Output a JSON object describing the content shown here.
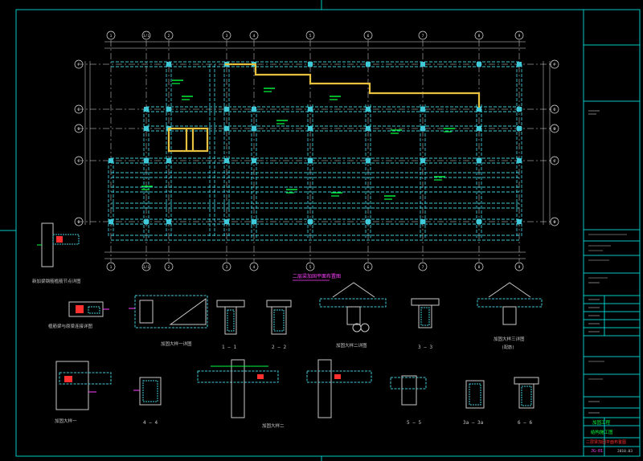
{
  "title_block": {
    "project_name": "加固工程",
    "stage": "结构施工图",
    "drawing_title": "二层梁加固平面布置图",
    "drawing_no": "JG-01",
    "date": "2010.03"
  },
  "plan": {
    "caption": "二层梁加固平面布置图",
    "grid_x": [
      "1",
      "1/1",
      "2",
      "3",
      "4",
      "5",
      "6",
      "7",
      "8",
      "9"
    ],
    "grid_y": [
      "F",
      "E",
      "D",
      "C",
      "B"
    ]
  },
  "details": {
    "d1": "新加梁钢筋植筋节点详图",
    "d2": "植筋梁与原梁连接详图",
    "d3": "加固大样一详图",
    "s11": "1 — 1",
    "s22": "2 — 2",
    "d4": "加固大样二详图",
    "s33": "3 — 3",
    "d5": "加固大样三详图",
    "d5_sub": "(配筋)",
    "d6": "加固大样一",
    "s44": "4 — 4",
    "d7": "加固大样二",
    "s55": "5 — 5",
    "s3a": "3a — 3a",
    "s66": "6 — 6"
  },
  "colors": {
    "background": "#000000",
    "frame": "#00c8c8",
    "beam_dashed": "#3fc8d8",
    "new_beam": "#e8c040",
    "axis": "#e0e0e0",
    "text_green": "#00ff40",
    "magenta": "#ff40ff",
    "red": "#ff3030"
  }
}
